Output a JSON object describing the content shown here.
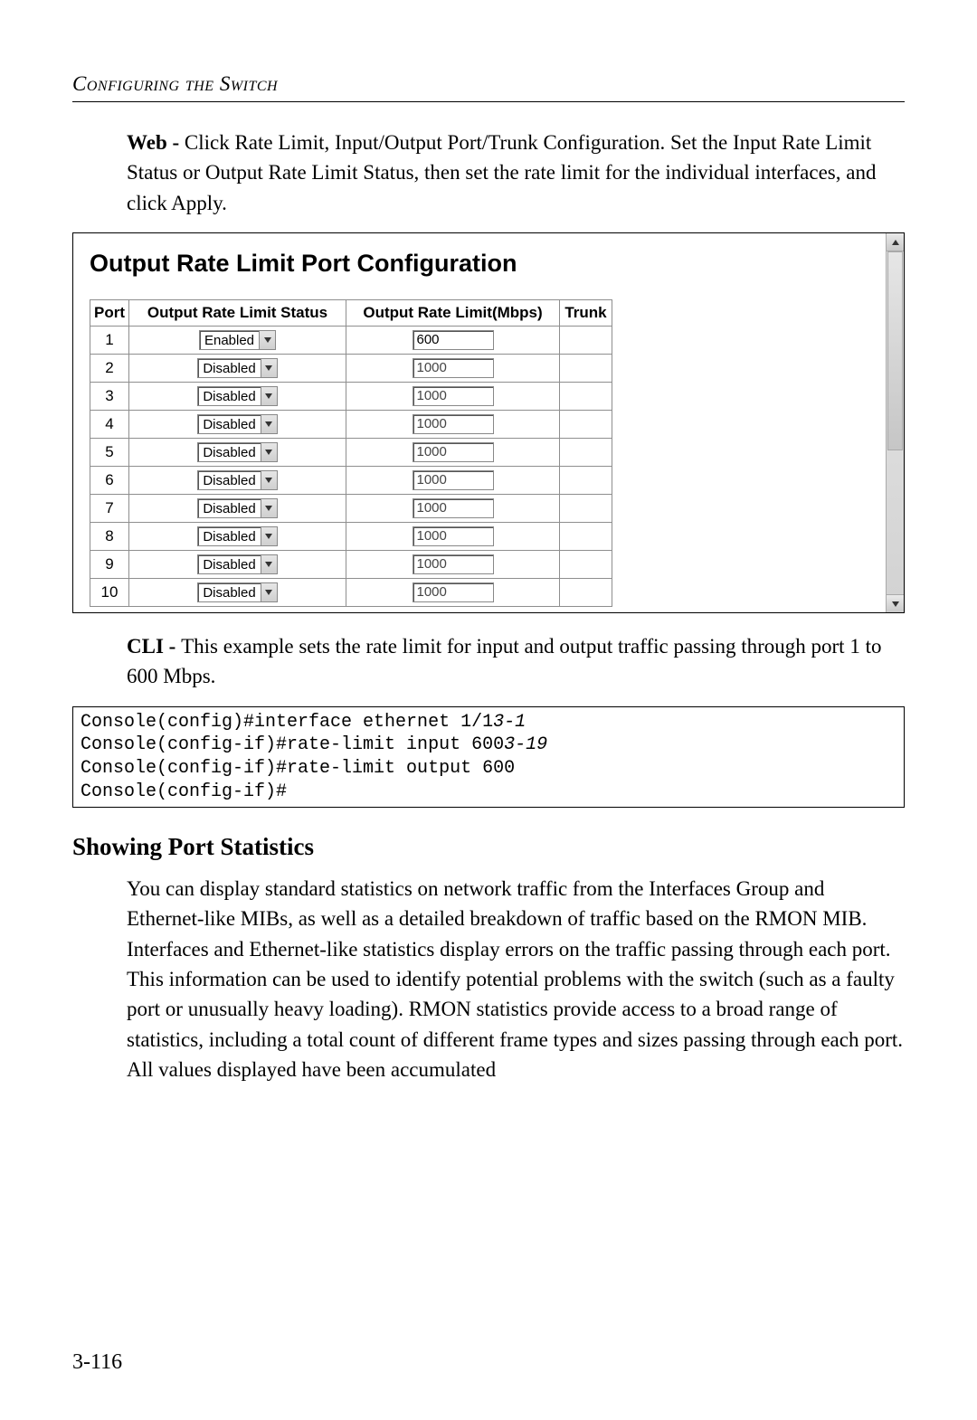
{
  "running_head": "Configuring the Switch",
  "intro": {
    "lead": "Web - ",
    "text": "Click Rate Limit, Input/Output Port/Trunk Configuration. Set the Input Rate Limit Status or Output Rate Limit Status, then set the rate limit for the individual interfaces, and click Apply."
  },
  "panel": {
    "title": "Output Rate Limit Port Configuration",
    "columns": {
      "port": "Port",
      "status": "Output Rate Limit Status",
      "rate": "Output Rate Limit(Mbps)",
      "trunk": "Trunk"
    },
    "rows": [
      {
        "port": "1",
        "status": "Enabled",
        "rate": "600",
        "trunk": "",
        "enabled": true
      },
      {
        "port": "2",
        "status": "Disabled",
        "rate": "1000",
        "trunk": "",
        "enabled": false
      },
      {
        "port": "3",
        "status": "Disabled",
        "rate": "1000",
        "trunk": "",
        "enabled": false
      },
      {
        "port": "4",
        "status": "Disabled",
        "rate": "1000",
        "trunk": "",
        "enabled": false
      },
      {
        "port": "5",
        "status": "Disabled",
        "rate": "1000",
        "trunk": "",
        "enabled": false
      },
      {
        "port": "6",
        "status": "Disabled",
        "rate": "1000",
        "trunk": "",
        "enabled": false
      },
      {
        "port": "7",
        "status": "Disabled",
        "rate": "1000",
        "trunk": "",
        "enabled": false
      },
      {
        "port": "8",
        "status": "Disabled",
        "rate": "1000",
        "trunk": "",
        "enabled": false
      },
      {
        "port": "9",
        "status": "Disabled",
        "rate": "1000",
        "trunk": "",
        "enabled": false
      },
      {
        "port": "10",
        "status": "Disabled",
        "rate": "1000",
        "trunk": "",
        "enabled": false
      }
    ]
  },
  "cli_lead": "CLI - ",
  "cli_text": "This example sets the rate limit for input and output traffic passing through port 1 to 600 Mbps.",
  "cli": {
    "line1a": "Console(config)#interface ethernet 1/1",
    "line1b": "3-1",
    "line2a": "Console(config-if)#rate-limit input 600",
    "line2b": "3-19",
    "line3": "Console(config-if)#rate-limit output 600",
    "line4": "Console(config-if)#"
  },
  "section_heading": "Showing Port Statistics",
  "section_body": "You can display standard statistics on network traffic from the Interfaces Group and Ethernet-like MIBs, as well as a detailed breakdown of traffic based on the RMON MIB. Interfaces and Ethernet-like statistics display errors on the traffic passing through each port. This information can be used to identify potential problems with the switch (such as a faulty port or unusually heavy loading). RMON statistics provide access to a broad range of statistics, including a total count of different frame types and sizes passing through each port. All values displayed have been accumulated",
  "page_number": "3-116"
}
